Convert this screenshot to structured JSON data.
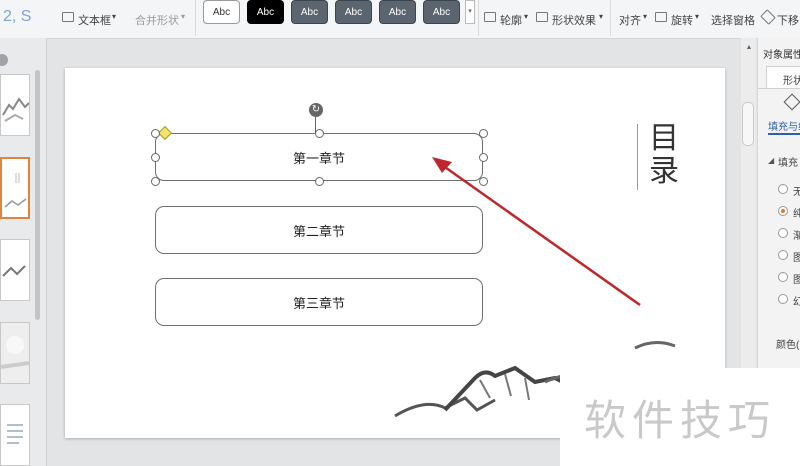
{
  "ribbon": {
    "textbox_label": "文本框",
    "merge_shapes_label": "合并形状",
    "outline_label": "轮廓",
    "shape_effects_label": "形状效果",
    "align_label": "对齐",
    "rotate_label": "旋转",
    "selection_pane_label": "选择窗格",
    "move_down_label": "下移",
    "style_presets": [
      {
        "label": "Abc"
      },
      {
        "label": "Abc"
      },
      {
        "label": "Abc"
      },
      {
        "label": "Abc"
      },
      {
        "label": "Abc"
      },
      {
        "label": "Abc"
      }
    ]
  },
  "slide": {
    "chapters": [
      "第一章节",
      "第二章节",
      "第三章节"
    ],
    "toc_title": "目录",
    "toc_char1": "目",
    "toc_char2": "录"
  },
  "right_panel": {
    "title": "对象属性",
    "tab_shape": "形状",
    "tab_fill_line": "填充与线条",
    "section_fill": "填充",
    "fill_options": [
      "无",
      "纯",
      "渐",
      "图",
      "图",
      "幻"
    ],
    "selected_fill_index": 1,
    "color_label": "颜色("
  },
  "watermark": "软件技巧",
  "colors": {
    "accent_orange": "#e0833c",
    "arrow_red": "#c0272d",
    "selection_handle_yellow": "#f2e36b"
  }
}
